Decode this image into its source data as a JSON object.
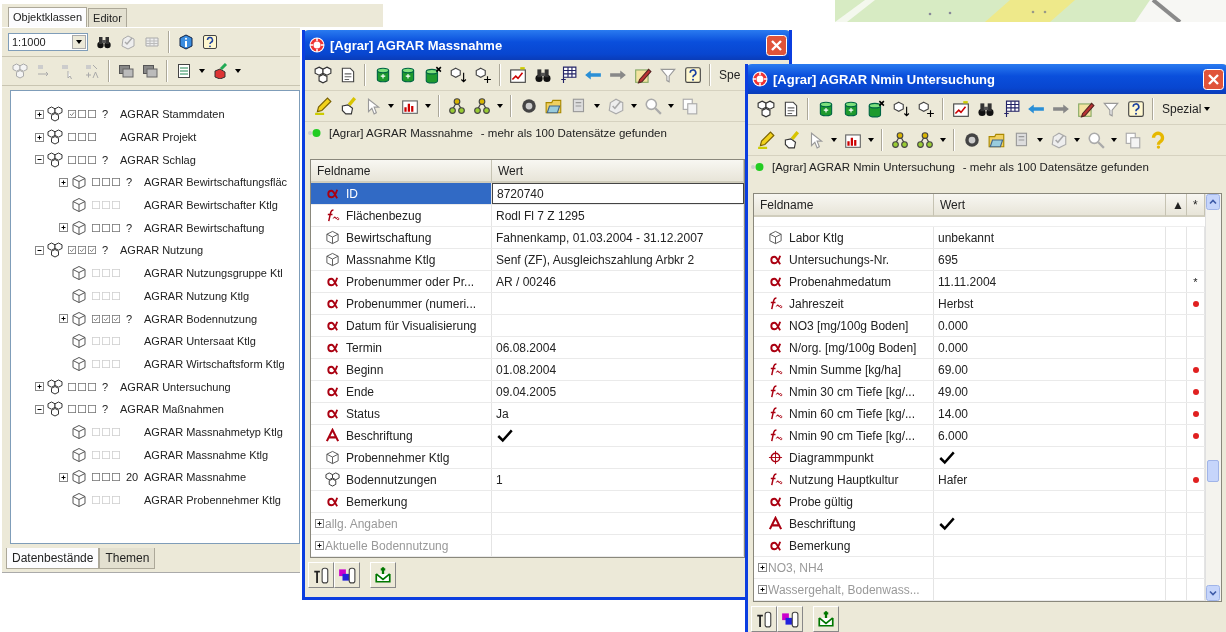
{
  "side_panel": {
    "tabs": [
      {
        "label": "Objektklassen",
        "selected": true
      },
      {
        "label": "Editor",
        "selected": false
      }
    ],
    "scale": "1:1000",
    "tree": [
      {
        "prefix": "?",
        "label": "AGRAR Stammdaten",
        "kind": "classes",
        "expanded": false,
        "disabled": false,
        "checks": [
          true,
          false,
          false
        ]
      },
      {
        "label": "AGRAR Projekt",
        "kind": "classes",
        "expanded": false,
        "disabled": false,
        "checks": [
          false,
          false,
          false
        ]
      },
      {
        "prefix": "?",
        "label": "AGRAR Schlag",
        "kind": "classes",
        "expanded": true,
        "disabled": false,
        "checks": [
          false,
          false,
          false
        ],
        "children": [
          {
            "prefix": "?",
            "label": "AGRAR Bewirtschaftungsfläc",
            "kind": "class",
            "expanded": false,
            "disabled": false,
            "checks": [
              false,
              false,
              false
            ]
          },
          {
            "label": "AGRAR Bewirtschafter Ktlg",
            "kind": "class",
            "disabled": true,
            "checks": [
              false,
              false,
              false
            ]
          },
          {
            "prefix": "?",
            "label": "AGRAR Bewirtschaftung",
            "kind": "class",
            "expanded": false,
            "disabled": false,
            "checks": [
              false,
              false,
              false
            ]
          }
        ]
      },
      {
        "prefix": "?",
        "label": "AGRAR Nutzung",
        "kind": "classes",
        "expanded": true,
        "disabled": false,
        "checks": [
          true,
          true,
          true
        ],
        "children": [
          {
            "label": "AGRAR Nutzungsgruppe Ktl",
            "kind": "class",
            "disabled": true,
            "checks": [
              false,
              false,
              false
            ]
          },
          {
            "label": "AGRAR Nutzung Ktlg",
            "kind": "class",
            "disabled": true,
            "checks": [
              false,
              false,
              false
            ]
          },
          {
            "prefix": "?",
            "label": "AGRAR Bodennutzung",
            "kind": "class",
            "expanded": false,
            "disabled": false,
            "checks": [
              true,
              true,
              true
            ]
          },
          {
            "label": "AGRAR Untersaat Ktlg",
            "kind": "class",
            "disabled": true,
            "checks": [
              false,
              false,
              false
            ]
          },
          {
            "label": "AGRAR Wirtschaftsform Ktlg",
            "kind": "class",
            "disabled": true,
            "checks": [
              false,
              false,
              false
            ]
          }
        ]
      },
      {
        "prefix": "?",
        "label": "AGRAR Untersuchung",
        "kind": "classes",
        "expanded": false,
        "disabled": false,
        "checks": [
          false,
          false,
          false
        ]
      },
      {
        "prefix": "?",
        "label": "AGRAR Maßnahmen",
        "kind": "classes",
        "expanded": true,
        "disabled": false,
        "checks": [
          false,
          false,
          false
        ],
        "children": [
          {
            "label": "AGRAR Massnahmetyp Ktlg",
            "kind": "class",
            "disabled": true,
            "checks": [
              false,
              false,
              false
            ]
          },
          {
            "label": "AGRAR Massnahme Ktlg",
            "kind": "class",
            "disabled": true,
            "checks": [
              false,
              false,
              false
            ]
          },
          {
            "prefix": "20",
            "label": "AGRAR Massnahme",
            "kind": "class",
            "expanded": false,
            "disabled": false,
            "checks": [
              false,
              false,
              false
            ]
          },
          {
            "label": "AGRAR Probennehmer Ktlg",
            "kind": "class",
            "disabled": true,
            "checks": [
              false,
              false,
              false
            ]
          }
        ]
      }
    ],
    "bottom_tabs": [
      {
        "label": "Datenbestände",
        "selected": true
      },
      {
        "label": "Themen",
        "selected": false
      }
    ]
  },
  "windows": [
    {
      "title": "[Agrar] AGRAR Massnahme",
      "menu": "Spe",
      "status": {
        "source": "[Agrar] AGRAR Massnahme",
        "message": "- mehr als 100 Datensätze gefunden"
      },
      "table": {
        "columns": [
          "Feldname",
          "Wert"
        ],
        "rows": [
          {
            "name": "ID",
            "kind": "text",
            "value": "8720740",
            "selected": true,
            "checked": false
          },
          {
            "name": "Flächenbezug",
            "kind": "formula",
            "value": "Rodl Fl 7 Z 1295",
            "selected": false,
            "checked": false
          },
          {
            "name": "Bewirtschaftung",
            "kind": "object",
            "value": "Fahnenkamp, 01.03.2004 - 31.12.2007",
            "selected": false,
            "checked": false
          },
          {
            "name": "Massnahme Ktlg",
            "kind": "object",
            "value": "Senf (ZF), Ausgleichszahlung Arbkr 2",
            "selected": false,
            "checked": false
          },
          {
            "name": "Probenummer oder Pr...",
            "kind": "text",
            "value": "AR / 00246",
            "selected": false,
            "checked": false
          },
          {
            "name": "Probenummer (numeri...",
            "kind": "text",
            "selected": false,
            "checked": false
          },
          {
            "name": "Datum für Visualisierung",
            "kind": "text",
            "selected": false,
            "checked": false
          },
          {
            "name": "Termin",
            "kind": "text",
            "value": "06.08.2004",
            "selected": false,
            "checked": false
          },
          {
            "name": "Beginn",
            "kind": "text",
            "value": "01.08.2004",
            "selected": false,
            "checked": false
          },
          {
            "name": "Ende",
            "kind": "text",
            "value": "09.04.2005",
            "selected": false,
            "checked": false
          },
          {
            "name": "Status",
            "kind": "text",
            "value": "Ja",
            "selected": false,
            "checked": false
          },
          {
            "name": "Beschriftung",
            "kind": "label",
            "selected": false,
            "checked": true
          },
          {
            "name": "Probennehmer Ktlg",
            "kind": "object",
            "selected": false,
            "checked": false
          },
          {
            "name": "Bodennutzungen",
            "kind": "objects",
            "value": "1",
            "selected": false,
            "checked": false
          },
          {
            "name": "Bemerkung",
            "kind": "text",
            "selected": false,
            "checked": false
          },
          {
            "name": "allg. Angaben",
            "kind": "group",
            "expanded": false,
            "selected": false
          },
          {
            "name": "Aktuelle Bodennutzung",
            "kind": "group",
            "expanded": false,
            "selected": false
          }
        ]
      }
    },
    {
      "title": "[Agrar] AGRAR Nmin Untersuchung",
      "menu": "Spezial",
      "status": {
        "source": "[Agrar] AGRAR Nmin Untersuchung",
        "message": "- mehr als 100 Datensätze gefunden"
      },
      "table": {
        "columns": [
          "Feldname",
          "Wert",
          "▲",
          "*"
        ],
        "rows": [
          {
            "name": "Labor Ktlg",
            "kind": "object",
            "value": "unbekannt",
            "selected": false,
            "checked": false,
            "dot": false
          },
          {
            "name": "Untersuchungs-Nr.",
            "kind": "text",
            "value": "695",
            "selected": false,
            "checked": false,
            "dot": false
          },
          {
            "name": "Probenahmedatum",
            "kind": "text",
            "value": "11.11.2004",
            "selected": false,
            "checked": false,
            "dot": false,
            "column_4": "*"
          },
          {
            "name": "Jahreszeit",
            "kind": "formula",
            "value": "Herbst",
            "selected": false,
            "checked": false,
            "dot": true
          },
          {
            "name": "NO3 [mg/100g Boden]",
            "kind": "text",
            "value": "0.000",
            "selected": false,
            "checked": false,
            "dot": false
          },
          {
            "name": "N/org. [mg/100g Boden]",
            "kind": "text",
            "value": "0.000",
            "selected": false,
            "checked": false,
            "dot": false
          },
          {
            "name": "Nmin Summe [kg/ha]",
            "kind": "formula",
            "value": "69.00",
            "selected": false,
            "checked": false,
            "dot": true
          },
          {
            "name": "Nmin 30 cm Tiefe [kg/...",
            "kind": "formula",
            "value": "49.00",
            "selected": false,
            "checked": false,
            "dot": true
          },
          {
            "name": "Nmin 60 cm Tiefe [kg/...",
            "kind": "formula",
            "value": "14.00",
            "selected": false,
            "checked": false,
            "dot": true
          },
          {
            "name": "Nmin 90 cm Tiefe [kg/...",
            "kind": "formula",
            "value": "6.000",
            "selected": false,
            "checked": false,
            "dot": true
          },
          {
            "name": "Diagrammpunkt",
            "kind": "point",
            "selected": false,
            "checked": true,
            "dot": false
          },
          {
            "name": "Nutzung Hauptkultur",
            "kind": "formula",
            "value": "Hafer",
            "selected": false,
            "checked": false,
            "dot": true
          },
          {
            "name": "Probe gültig",
            "kind": "text",
            "selected": false,
            "checked": false,
            "dot": false
          },
          {
            "name": "Beschriftung",
            "kind": "label",
            "selected": false,
            "checked": true,
            "dot": false
          },
          {
            "name": "Bemerkung",
            "kind": "text",
            "selected": false,
            "checked": false,
            "dot": false
          },
          {
            "name": "NO3, NH4",
            "kind": "group",
            "expanded": false,
            "selected": false
          },
          {
            "name": "Wassergehalt, Bodenwass...",
            "kind": "group",
            "expanded": false,
            "selected": false
          }
        ]
      }
    }
  ]
}
